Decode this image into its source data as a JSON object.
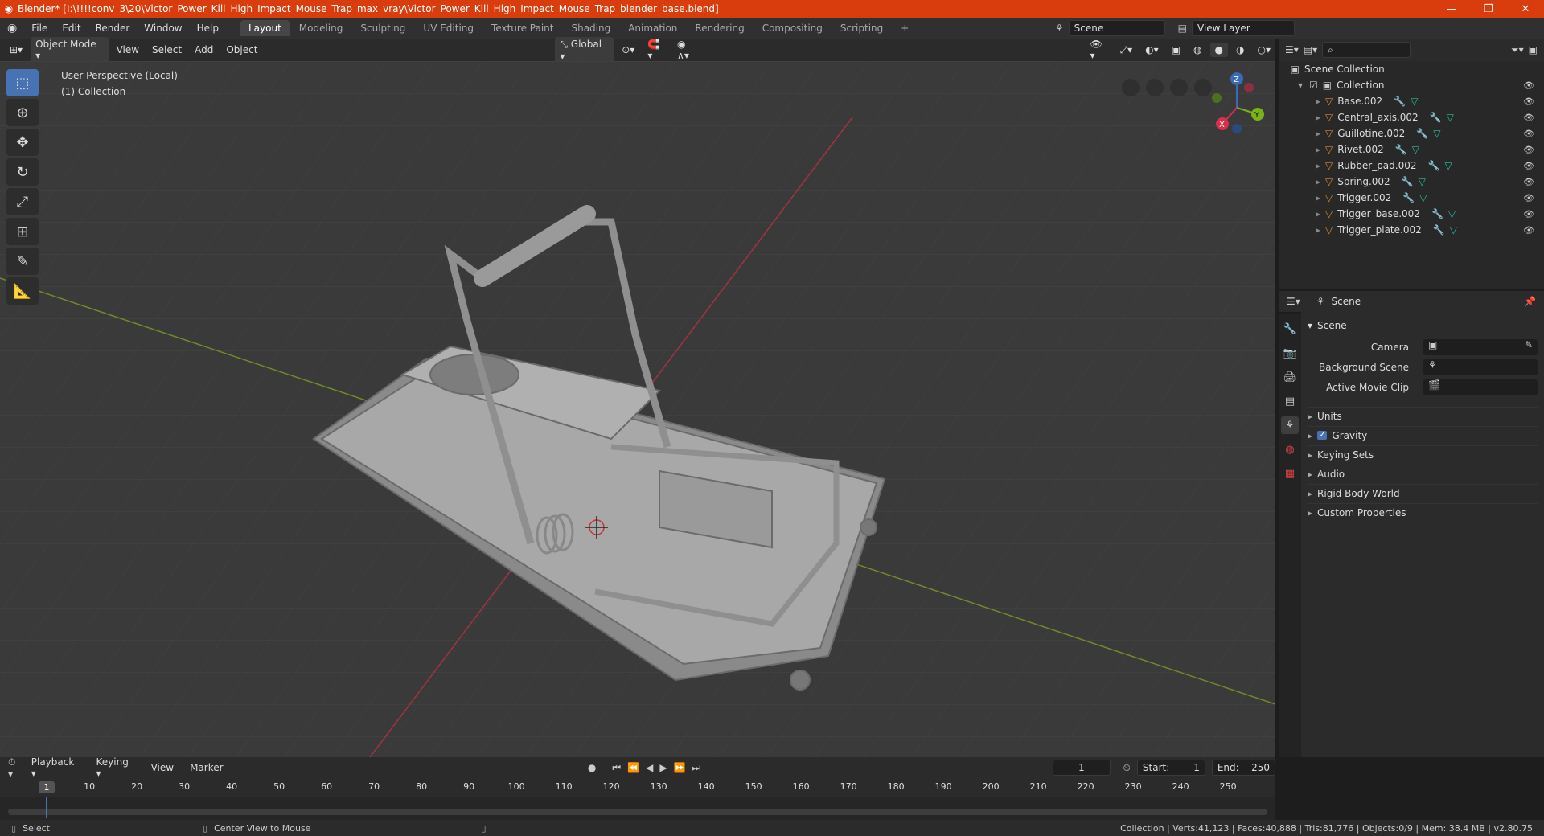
{
  "window": {
    "title": "Blender* [I:\\!!!!conv_3\\20\\Victor_Power_Kill_High_Impact_Mouse_Trap_max_vray\\Victor_Power_Kill_High_Impact_Mouse_Trap_blender_base.blend]",
    "minimize": "—",
    "maximize": "❐",
    "close": "✕",
    "accent": "#d93d0e"
  },
  "menu": {
    "items": [
      "File",
      "Edit",
      "Render",
      "Window",
      "Help"
    ],
    "workspaces": [
      "Layout",
      "Modeling",
      "Sculpting",
      "UV Editing",
      "Texture Paint",
      "Shading",
      "Animation",
      "Rendering",
      "Compositing",
      "Scripting"
    ],
    "add_tab": "+",
    "scene": "Scene",
    "view_layer": "View Layer"
  },
  "viewport": {
    "mode": "Object Mode",
    "menus": [
      "View",
      "Select",
      "Add",
      "Object"
    ],
    "orientation": "Global",
    "perspective_label": "User Perspective (Local)",
    "collection_label": "(1) Collection",
    "gizmo": {
      "x": "X",
      "y": "Y",
      "z": "Z"
    }
  },
  "outliner": {
    "root": "Scene Collection",
    "collection": "Collection",
    "objects": [
      "Base.002",
      "Central_axis.002",
      "Guillotine.002",
      "Rivet.002",
      "Rubber_pad.002",
      "Spring.002",
      "Trigger.002",
      "Trigger_base.002",
      "Trigger_plate.002"
    ]
  },
  "properties": {
    "context": "Scene",
    "panel": "Scene",
    "fields": {
      "camera": "Camera",
      "background_scene": "Background Scene",
      "active_movie_clip": "Active Movie Clip"
    },
    "subpanels": [
      "Units",
      "Gravity",
      "Keying Sets",
      "Audio",
      "Rigid Body World",
      "Custom Properties"
    ],
    "gravity_checked": true
  },
  "timeline": {
    "menus": [
      "Playback",
      "Keying",
      "View",
      "Marker"
    ],
    "current_frame": "1",
    "start_label": "Start:",
    "start": "1",
    "end_label": "End:",
    "end": "250",
    "ruler": [
      "1",
      "10",
      "20",
      "30",
      "40",
      "50",
      "60",
      "70",
      "80",
      "90",
      "100",
      "110",
      "120",
      "130",
      "140",
      "150",
      "160",
      "170",
      "180",
      "190",
      "200",
      "210",
      "220",
      "230",
      "240",
      "250"
    ]
  },
  "status": {
    "select": "Select",
    "center": "Center View to Mouse",
    "stats": "Collection | Verts:41,123 | Faces:40,888 | Tris:81,776 | Objects:0/9 | Mem: 38.4 MB | v2.80.75"
  }
}
